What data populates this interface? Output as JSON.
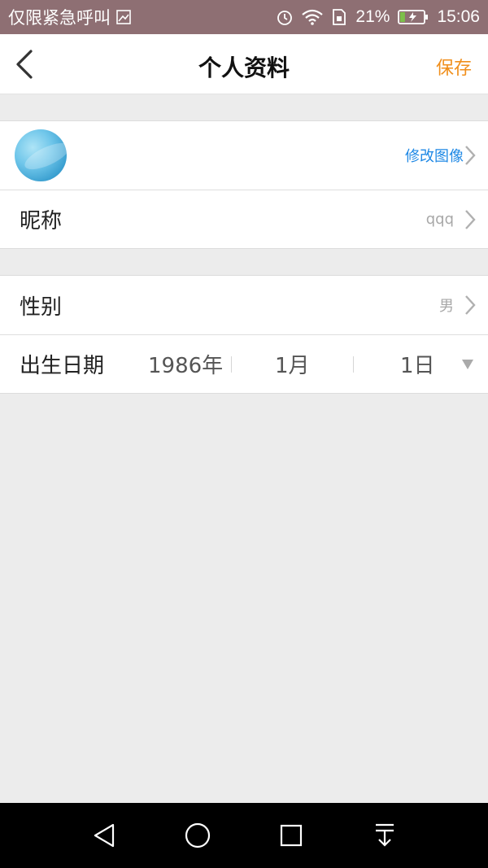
{
  "status_bar": {
    "carrier_text": "仅限紧急呼叫",
    "battery_percent": "21%",
    "time": "15:06",
    "battery_level": 0.21,
    "icons": [
      "image-icon",
      "alarm-icon",
      "wifi-icon",
      "sim-icon",
      "battery-charging-icon"
    ]
  },
  "header": {
    "title": "个人资料",
    "save_label": "保存",
    "back_icon": "back-arrow-icon"
  },
  "profile": {
    "avatar_link": "修改图像",
    "nickname_label": "昵称",
    "nickname_value": "qqq",
    "gender_label": "性别",
    "gender_value": "男",
    "birthdate_label": "出生日期",
    "birth_year": "1986年",
    "birth_month": "1月",
    "birth_day": "1日"
  },
  "nav_bar": {
    "buttons": [
      "back-nav-icon",
      "home-nav-icon",
      "recents-nav-icon",
      "notification-pull-icon"
    ]
  },
  "colors": {
    "status_bar_bg": "#8e6f73",
    "accent_orange": "#f08f1c",
    "link_blue": "#1e88e5",
    "background": "#ececec"
  }
}
